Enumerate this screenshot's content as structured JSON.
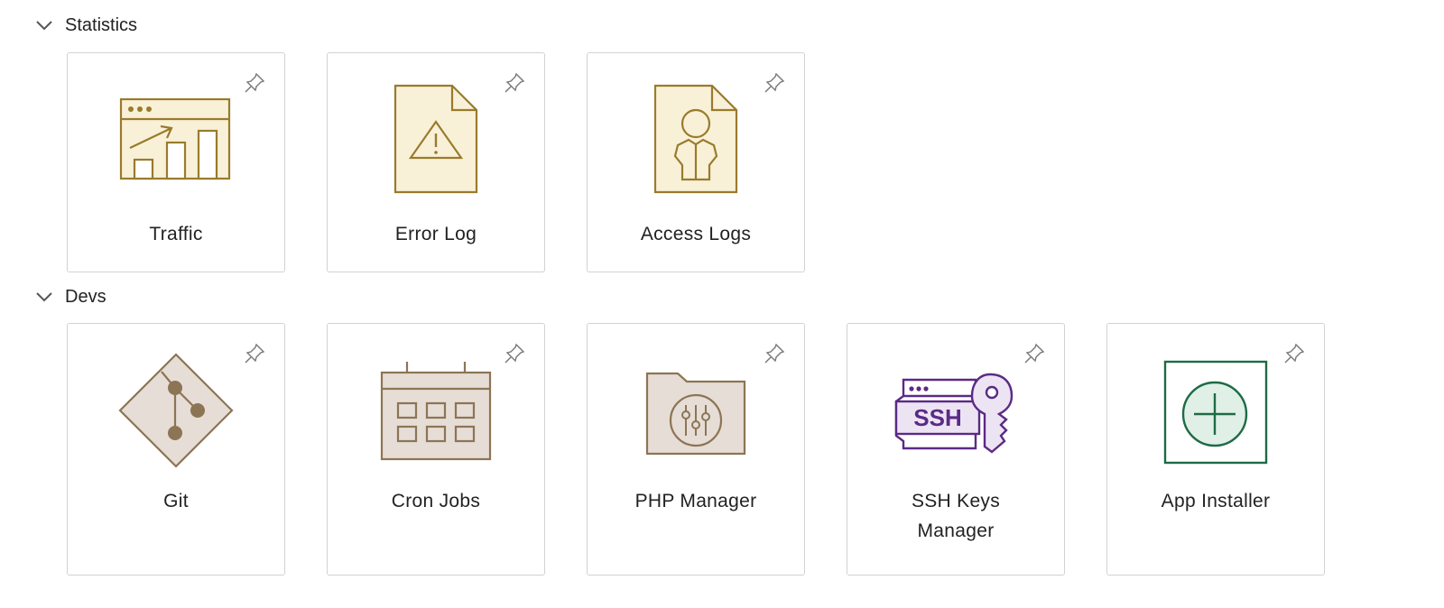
{
  "sections": [
    {
      "title": "Statistics",
      "items": [
        {
          "label": "Traffic",
          "icon": "traffic-chart-icon"
        },
        {
          "label": "Error Log",
          "icon": "error-log-icon"
        },
        {
          "label": "Access Logs",
          "icon": "access-logs-icon"
        }
      ]
    },
    {
      "title": "Devs",
      "items": [
        {
          "label": "Git",
          "icon": "git-icon"
        },
        {
          "label": "Cron Jobs",
          "icon": "calendar-icon"
        },
        {
          "label": "PHP Manager",
          "icon": "php-folder-icon"
        },
        {
          "label": "SSH Keys\nManager",
          "icon": "ssh-key-icon",
          "icon_text": "SSH"
        },
        {
          "label": "App Installer",
          "icon": "plus-installer-icon"
        }
      ]
    }
  ],
  "colors": {
    "stat_stroke": "#9a7b2c",
    "stat_fill": "#f8f1d8",
    "dev_stroke": "#8c7555",
    "dev_fill": "#e6ddd6",
    "ssh_stroke": "#5b2a86",
    "ssh_fill": "#ece4f3",
    "installer_stroke": "#1e6b45",
    "installer_fill": "#e0f0e6"
  }
}
